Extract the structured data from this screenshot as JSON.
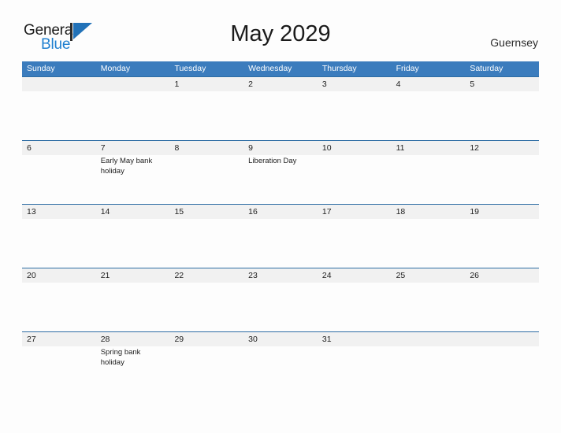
{
  "brand": {
    "name_part1": "General",
    "name_part2": "Blue",
    "logo_icon": "triangle-flag-icon"
  },
  "header": {
    "title": "May 2029",
    "region": "Guernsey"
  },
  "calendar": {
    "weekday_headers": [
      "Sunday",
      "Monday",
      "Tuesday",
      "Wednesday",
      "Thursday",
      "Friday",
      "Saturday"
    ],
    "colors": {
      "header_blue": "#3b7cbd",
      "rule_blue": "#2e6da4",
      "row_band": "#f1f1f1",
      "page_background": "#fdfdfd",
      "brand_blue": "#1f7fd0"
    },
    "weeks": [
      [
        {
          "date": "",
          "event": ""
        },
        {
          "date": "",
          "event": ""
        },
        {
          "date": "1",
          "event": ""
        },
        {
          "date": "2",
          "event": ""
        },
        {
          "date": "3",
          "event": ""
        },
        {
          "date": "4",
          "event": ""
        },
        {
          "date": "5",
          "event": ""
        }
      ],
      [
        {
          "date": "6",
          "event": ""
        },
        {
          "date": "7",
          "event": "Early May bank holiday"
        },
        {
          "date": "8",
          "event": ""
        },
        {
          "date": "9",
          "event": "Liberation Day"
        },
        {
          "date": "10",
          "event": ""
        },
        {
          "date": "11",
          "event": ""
        },
        {
          "date": "12",
          "event": ""
        }
      ],
      [
        {
          "date": "13",
          "event": ""
        },
        {
          "date": "14",
          "event": ""
        },
        {
          "date": "15",
          "event": ""
        },
        {
          "date": "16",
          "event": ""
        },
        {
          "date": "17",
          "event": ""
        },
        {
          "date": "18",
          "event": ""
        },
        {
          "date": "19",
          "event": ""
        }
      ],
      [
        {
          "date": "20",
          "event": ""
        },
        {
          "date": "21",
          "event": ""
        },
        {
          "date": "22",
          "event": ""
        },
        {
          "date": "23",
          "event": ""
        },
        {
          "date": "24",
          "event": ""
        },
        {
          "date": "25",
          "event": ""
        },
        {
          "date": "26",
          "event": ""
        }
      ],
      [
        {
          "date": "27",
          "event": ""
        },
        {
          "date": "28",
          "event": "Spring bank holiday"
        },
        {
          "date": "29",
          "event": ""
        },
        {
          "date": "30",
          "event": ""
        },
        {
          "date": "31",
          "event": ""
        },
        {
          "date": "",
          "event": ""
        },
        {
          "date": "",
          "event": ""
        }
      ]
    ]
  }
}
